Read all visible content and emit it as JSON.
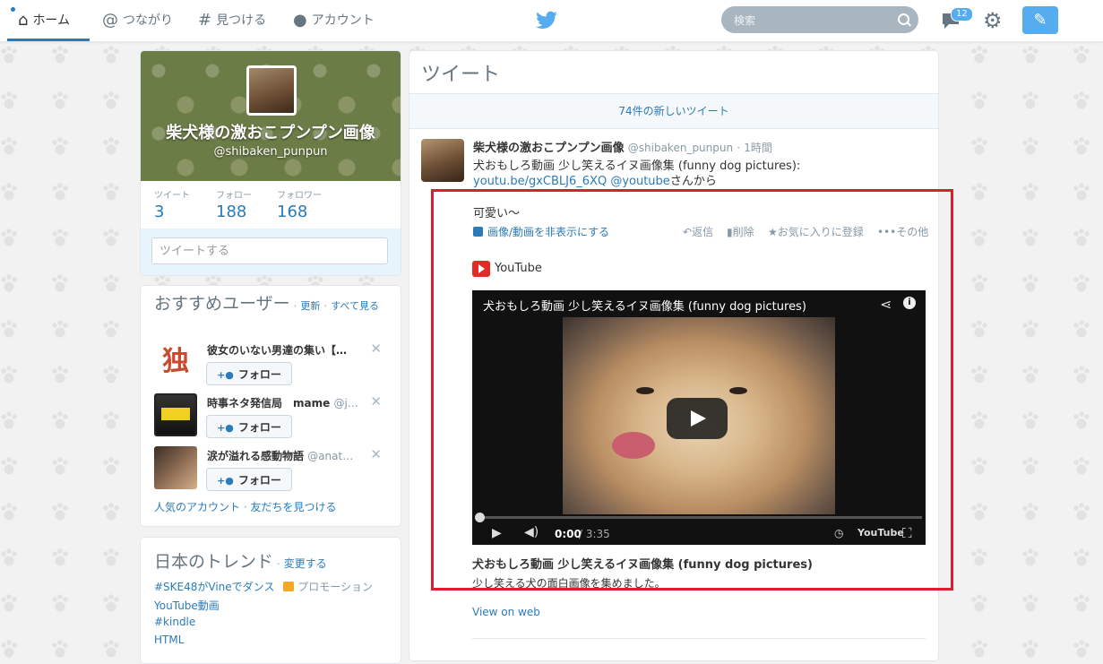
{
  "nav": {
    "home": "ホーム",
    "connect": "つながり",
    "discover": "見つける",
    "account": "アカウント",
    "search_placeholder": "検索",
    "messages_badge": "12"
  },
  "profile": {
    "name": "柴犬様の激おこプンプン画像",
    "handle": "@shibaken_punpun",
    "stats": [
      {
        "label": "ツイート",
        "value": "3"
      },
      {
        "label": "フォロー",
        "value": "188"
      },
      {
        "label": "フォロワー",
        "value": "168"
      }
    ],
    "compose_placeholder": "ツイートする"
  },
  "wtf": {
    "title": "おすすめユーザー",
    "refresh": "更新",
    "view_all": "すべて見る",
    "users": [
      {
        "name": "彼女のいない男達の集い【…",
        "handle": "",
        "follow": "フォロー"
      },
      {
        "name": "時事ネタ発信局　mame",
        "handle": "@j…",
        "follow": "フォロー"
      },
      {
        "name": "涙が溢れる感動物語",
        "handle": "@anat…",
        "follow": "フォロー"
      }
    ],
    "popular": "人気のアカウント",
    "find_friends": "友だちを見つける"
  },
  "trends": {
    "title": "日本のトレンド",
    "change": "変更する",
    "promoted": "プロモーション",
    "items": [
      "#SKE48がVineでダンス",
      "YouTube動画",
      "#kindle",
      "HTML"
    ]
  },
  "stream": {
    "title": "ツイート",
    "new_tweets": "74件の新しいツイート",
    "tweet": {
      "name": "柴犬様の激おこプンプン画像",
      "handle": "@shibaken_punpun",
      "time": "1時間",
      "text1": "犬おもしろ動画 少し笑えるイヌ画像集 (funny dog pictures):",
      "link": "youtu.be/gxCBLJ6_6XQ",
      "mention": "@youtube",
      "suffix": "さんから",
      "comment": "可愛い～",
      "hide_media": "画像/動画を非表示にする",
      "reply": "返信",
      "delete": "削除",
      "favorite": "お気に入りに登録",
      "more": "その他",
      "provider": "YouTube",
      "video_title": "犬おもしろ動画 少し笑えるイヌ画像集 (funny dog pictures)",
      "time_current": "0:00",
      "time_total": "/ 3:35",
      "card_title": "犬おもしろ動画 少し笑えるイヌ画像集 (funny dog pictures)",
      "card_desc": "少し笑える犬の面白画像を集めました。",
      "view_on_web": "View on web"
    }
  },
  "colors": {
    "accent": "#2b7bb9",
    "highlight_box": "#dc1e2e",
    "twitter_blue": "#55acee"
  }
}
